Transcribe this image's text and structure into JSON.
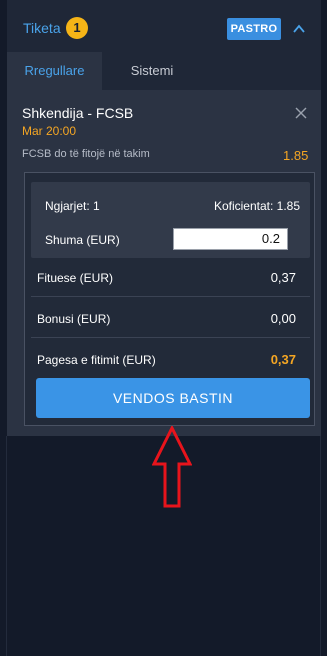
{
  "header": {
    "title": "Tiketa",
    "count": "1",
    "clear_label": "PASTRO"
  },
  "tabs": [
    {
      "label": "Rregullare",
      "active": true
    },
    {
      "label": "Sistemi",
      "active": false
    }
  ],
  "selection": {
    "match": "Shkendija - FCSB",
    "time": "Mar 20:00",
    "market": "FCSB do të fitojë në takim",
    "odds": "1.85"
  },
  "slip": {
    "events_label": "Ngjarjet: 1",
    "odds_label": "Koficientat: 1.85",
    "stake_label": "Shuma (EUR)",
    "stake_value": "0.2",
    "rows": [
      {
        "label": "Fituese (EUR)",
        "value": "0,37"
      },
      {
        "label": "Bonusi (EUR)",
        "value": "0,00"
      },
      {
        "label": "Pagesa e fitimit (EUR)",
        "value": "0,37"
      }
    ],
    "place_bet_label": "VENDOS BASTIN"
  },
  "colors": {
    "accent_blue": "#3a94e6",
    "highlight_orange": "#f5a623",
    "badge_yellow": "#f5b417",
    "annotation_red": "#e8141c"
  },
  "icons": {
    "collapse": "chevron-up-icon",
    "remove": "close-icon",
    "annotation": "red-arrow-up-icon"
  }
}
